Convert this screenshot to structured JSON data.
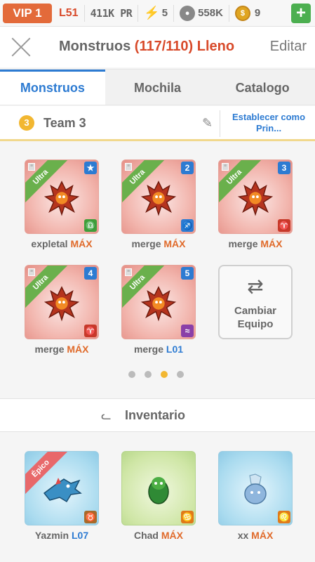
{
  "status": {
    "vip": "VIP 1",
    "level": "L51",
    "power": "411K PR",
    "energy": "5",
    "food": "558K",
    "coins": "9",
    "plus": "+"
  },
  "header": {
    "title": "Monstruos",
    "count": "(117/110)",
    "full": "Lleno",
    "edit": "Editar"
  },
  "tabs": [
    {
      "label": "Monstruos"
    },
    {
      "label": "Mochila"
    },
    {
      "label": "Catalogo"
    }
  ],
  "team": {
    "number": "3",
    "name": "Team 3",
    "set_main": "Establecer como Prin..."
  },
  "monsters": [
    {
      "name": "expletal",
      "level": "MÁX",
      "ribbon": "Ultra",
      "slot": "★",
      "zodiac": "♎"
    },
    {
      "name": "merge",
      "level": "MÁX",
      "ribbon": "Ultra",
      "slot": "2",
      "zodiac": "♐"
    },
    {
      "name": "merge",
      "level": "MÁX",
      "ribbon": "Ultra",
      "slot": "3",
      "zodiac": "♈"
    },
    {
      "name": "merge",
      "level": "MÁX",
      "ribbon": "Ultra",
      "slot": "4",
      "zodiac": "♈"
    },
    {
      "name": "merge",
      "level": "L01",
      "ribbon": "Ultra",
      "slot": "5",
      "zodiac": "≈"
    }
  ],
  "swap_team": {
    "line1": "Cambiar",
    "line2": "Equipo"
  },
  "pagination": {
    "total": 4,
    "active": 3
  },
  "inventory": {
    "title": "Inventario",
    "items": [
      {
        "name": "Yazmin",
        "level": "L07",
        "ribbon": "Épico",
        "zodiac": "♉"
      },
      {
        "name": "Chad",
        "level": "MÁX",
        "ribbon": "",
        "zodiac": "♋"
      },
      {
        "name": "xx",
        "level": "MÁX",
        "ribbon": "",
        "zodiac": "♌"
      }
    ]
  },
  "colors": {
    "accent_blue": "#2d7bd2",
    "alert_red": "#d84a2a",
    "level_orange": "#e06a2a",
    "ultra_green": "#6ab04c",
    "epic_pink": "#e8686a",
    "team_gold": "#f2b731"
  }
}
